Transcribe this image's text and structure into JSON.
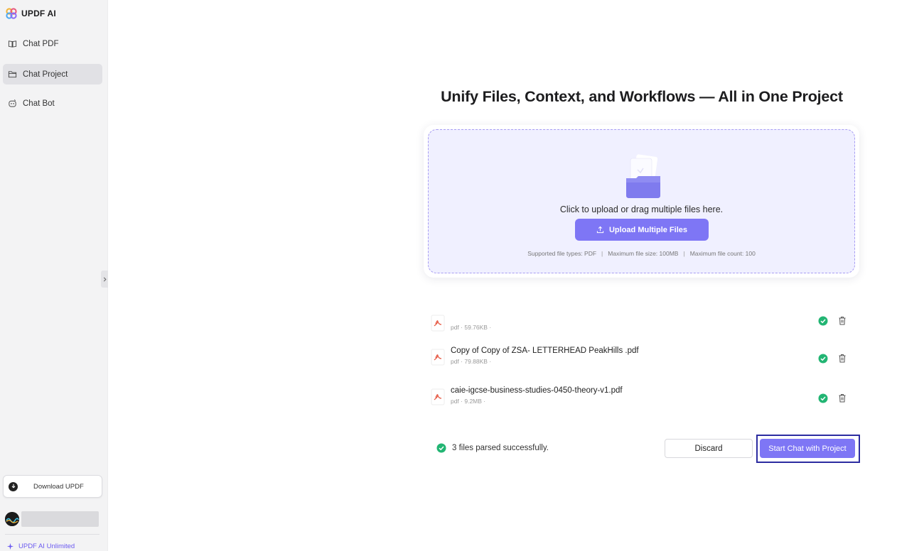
{
  "app": {
    "brand_name": "UPDF AI"
  },
  "sidebar": {
    "items": [
      {
        "label": "Chat PDF",
        "icon": "book-open-icon",
        "active": false
      },
      {
        "label": "Chat Project",
        "icon": "folder-icon",
        "active": true
      },
      {
        "label": "Chat Bot",
        "icon": "bot-icon",
        "active": false
      }
    ],
    "download_label": "Download UPDF",
    "unlimited_label": "UPDF AI Unlimited"
  },
  "main": {
    "headline": "Unify Files, Context, and Workflows — All in One Project",
    "dropzone": {
      "text": "Click to upload or drag multiple files here.",
      "upload_button": "Upload Multiple Files",
      "hint_types": "Supported file types: PDF",
      "hint_size": "Maximum file size: 100MB",
      "hint_count": "Maximum file count: 100"
    },
    "files": [
      {
        "name": "",
        "meta": "pdf · 59.76KB ·"
      },
      {
        "name": "Copy of Copy of ZSA- LETTERHEAD PeakHills .pdf",
        "meta": "pdf · 79.88KB ·"
      },
      {
        "name": "caie-igcse-business-studies-0450-theory-v1.pdf",
        "meta": "pdf · 9.2MB ·"
      }
    ],
    "status_text": "3 files parsed successfully.",
    "discard_button": "Discard",
    "start_button": "Start Chat with Project"
  },
  "colors": {
    "accent": "#7e76f5",
    "success": "#22b573",
    "pdf_red": "#e5533d",
    "focus_frame": "#2c2ca0"
  }
}
